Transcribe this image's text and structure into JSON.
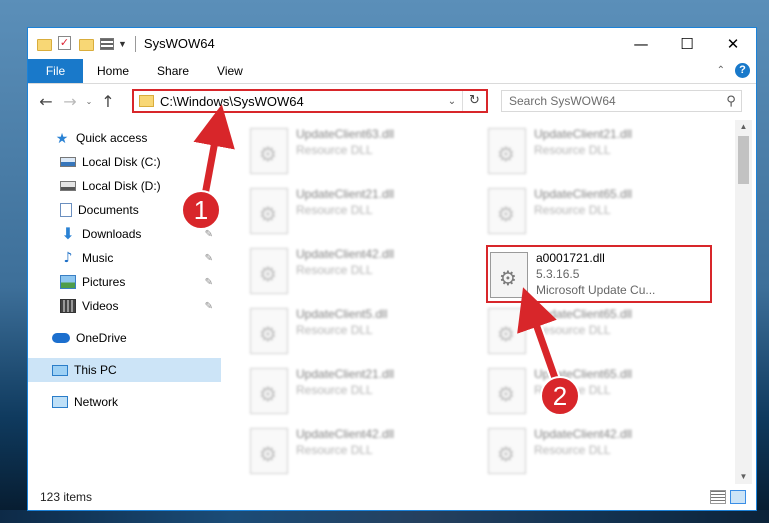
{
  "window": {
    "title": "SysWOW64",
    "controls": {
      "minimize": "—",
      "maximize": "☐",
      "close": "✕"
    }
  },
  "ribbon": {
    "file_tab": "File",
    "tabs": [
      "Home",
      "Share",
      "View"
    ],
    "collapse_glyph": "⌃",
    "help_glyph": "?"
  },
  "nav": {
    "back": "←",
    "forward": "→",
    "recent": "⌄",
    "up": "↑",
    "address": "C:\\Windows\\SysWOW64",
    "address_dropdown": "⌄",
    "refresh": "↻",
    "search_placeholder": "Search SysWOW64",
    "search_glyph": "⚲"
  },
  "sidebar": {
    "items": [
      {
        "label": "Quick access",
        "icon": "star-icon"
      },
      {
        "label": "Local Disk (C:)",
        "icon": "disk-icon"
      },
      {
        "label": "Local Disk (D:)",
        "icon": "disk-icon"
      },
      {
        "label": "Documents",
        "icon": "documents-icon"
      },
      {
        "label": "Downloads",
        "icon": "download-icon"
      },
      {
        "label": "Music",
        "icon": "music-icon"
      },
      {
        "label": "Pictures",
        "icon": "pictures-icon"
      },
      {
        "label": "Videos",
        "icon": "videos-icon"
      },
      {
        "label": "OneDrive",
        "icon": "cloud-icon"
      },
      {
        "label": "This PC",
        "icon": "computer-icon"
      },
      {
        "label": "Network",
        "icon": "network-icon"
      }
    ],
    "selected": "This PC",
    "pin_glyph": "✎"
  },
  "files": [
    {
      "name": "UpdateClient63.dll",
      "sub": "Resource DLL"
    },
    {
      "name": "UpdateClient21.dll",
      "sub": "Resource DLL"
    },
    {
      "name": "UpdateClient21.dll",
      "sub": "Resource DLL"
    },
    {
      "name": "UpdateClient65.dll",
      "sub": "Resource DLL"
    },
    {
      "name": "UpdateClient42.dll",
      "sub": "Resource DLL"
    },
    {
      "name": "a0001721.dll",
      "sub": "5.3.16.5",
      "sub2": "Microsoft Update Cu..."
    },
    {
      "name": "UpdateClient5.dll",
      "sub": "Resource DLL"
    },
    {
      "name": "UpdateClient65.dll",
      "sub": "Resource DLL"
    },
    {
      "name": "UpdateClient21.dll",
      "sub": "Resource DLL"
    },
    {
      "name": "UpdateClient65.dll",
      "sub": "Resource DLL"
    },
    {
      "name": "UpdateClient42.dll",
      "sub": "Resource DLL"
    },
    {
      "name": "UpdateClient42.dll",
      "sub": "Resource DLL"
    }
  ],
  "gear_glyph": "⚙",
  "status": {
    "item_count": "123 items"
  },
  "callouts": {
    "first": "1",
    "second": "2"
  },
  "colors": {
    "accent": "#1979ca",
    "highlight": "#d8262a",
    "selected_bg": "#cce4f7"
  }
}
